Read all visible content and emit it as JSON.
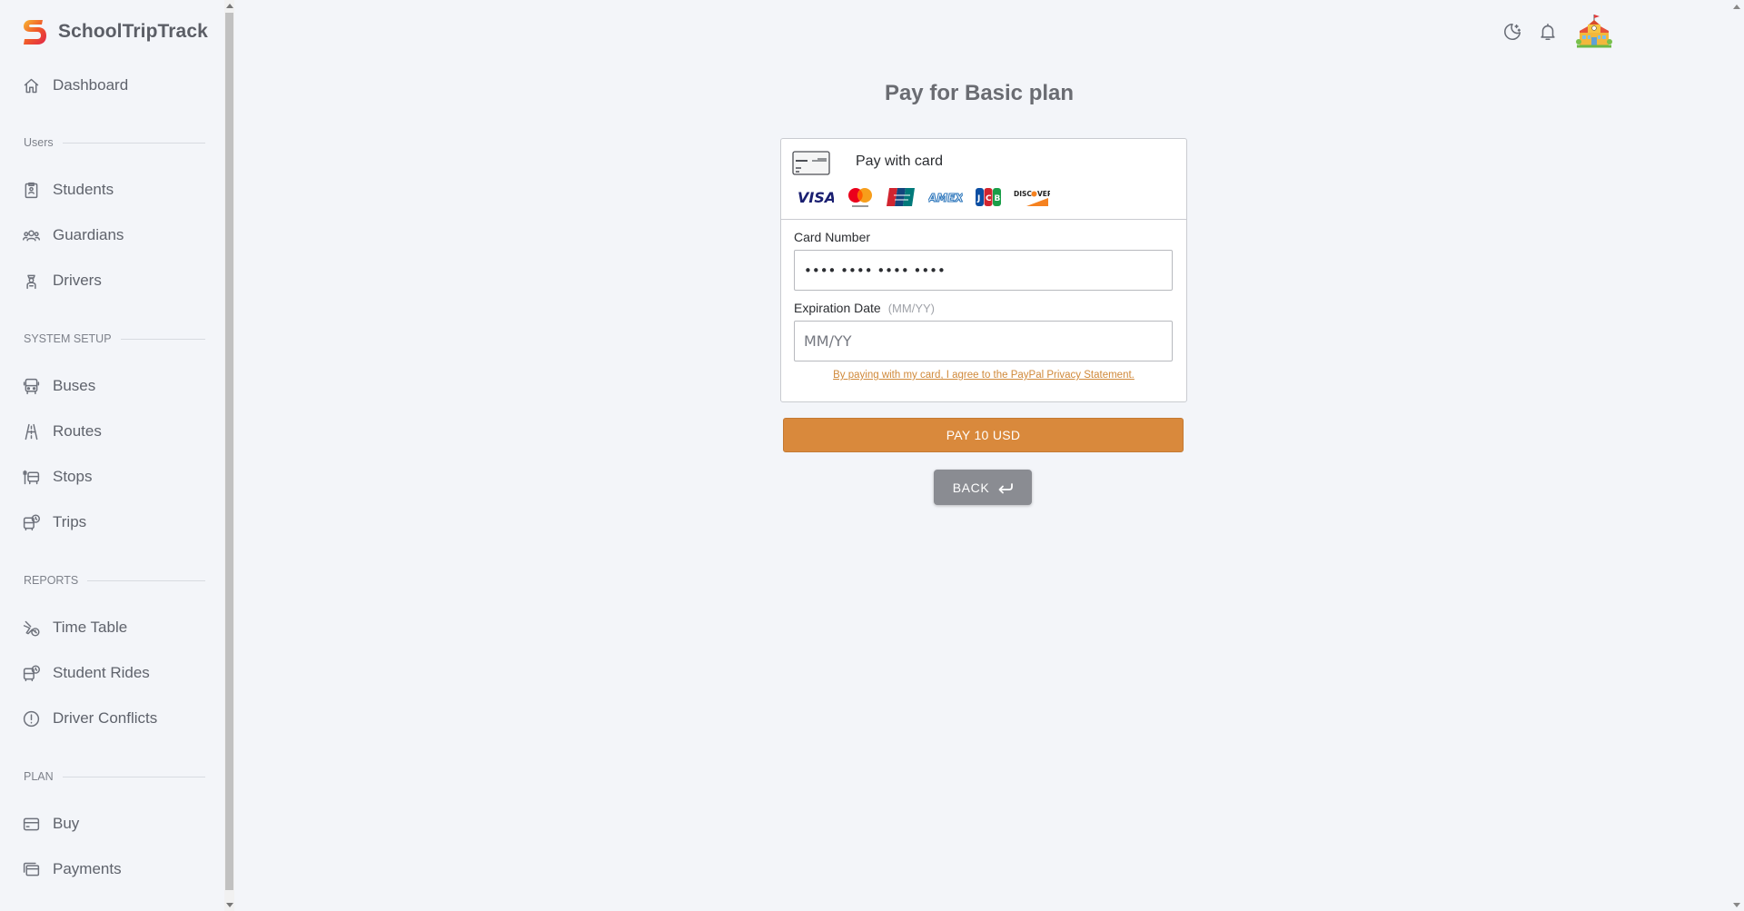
{
  "app": {
    "name": "SchoolTripTrack"
  },
  "sidebar": {
    "dashboard": {
      "label": "Dashboard",
      "icon": "home-icon"
    },
    "sections": {
      "users": "Users",
      "system_setup": "SYSTEM SETUP",
      "reports": "REPORTS",
      "plan": "PLAN"
    },
    "items": {
      "students": {
        "label": "Students",
        "icon": "clipboard-icon"
      },
      "guardians": {
        "label": "Guardians",
        "icon": "users-icon"
      },
      "drivers": {
        "label": "Drivers",
        "icon": "driver-icon"
      },
      "buses": {
        "label": "Buses",
        "icon": "bus-icon"
      },
      "routes": {
        "label": "Routes",
        "icon": "road-icon"
      },
      "stops": {
        "label": "Stops",
        "icon": "bus-stop-icon"
      },
      "trips": {
        "label": "Trips",
        "icon": "bus-clock-icon"
      },
      "time_table": {
        "label": "Time Table",
        "icon": "plane-clock-icon"
      },
      "student_rides": {
        "label": "Student Rides",
        "icon": "bus-clock-icon"
      },
      "driver_conflicts": {
        "label": "Driver Conflicts",
        "icon": "alert-circle-icon"
      },
      "buy": {
        "label": "Buy",
        "icon": "credit-card-icon"
      },
      "payments": {
        "label": "Payments",
        "icon": "cards-icon"
      }
    }
  },
  "topbar": {
    "theme_toggle_icon": "moon-stars-icon",
    "notifications_icon": "bell-icon",
    "avatar_icon": "school-building-icon"
  },
  "page": {
    "title": "Pay for Basic plan"
  },
  "payment_card": {
    "header_title": "Pay with card",
    "brands": [
      "VISA",
      "Mastercard",
      "UnionPay",
      "AMEX",
      "JCB",
      "DISCOVER"
    ],
    "card_number": {
      "label": "Card Number",
      "value": "•••• •••• •••• ••••"
    },
    "expiration": {
      "label": "Expiration Date",
      "hint": "(MM/YY)",
      "placeholder": "MM/YY"
    },
    "agreement": "By paying with my card, I agree to the PayPal Privacy Statement."
  },
  "buttons": {
    "pay": "PAY 10 USD",
    "back": "BACK"
  },
  "colors": {
    "accent": "#d9893c",
    "back_button": "#8a8c92",
    "background": "#f3f5f9"
  }
}
